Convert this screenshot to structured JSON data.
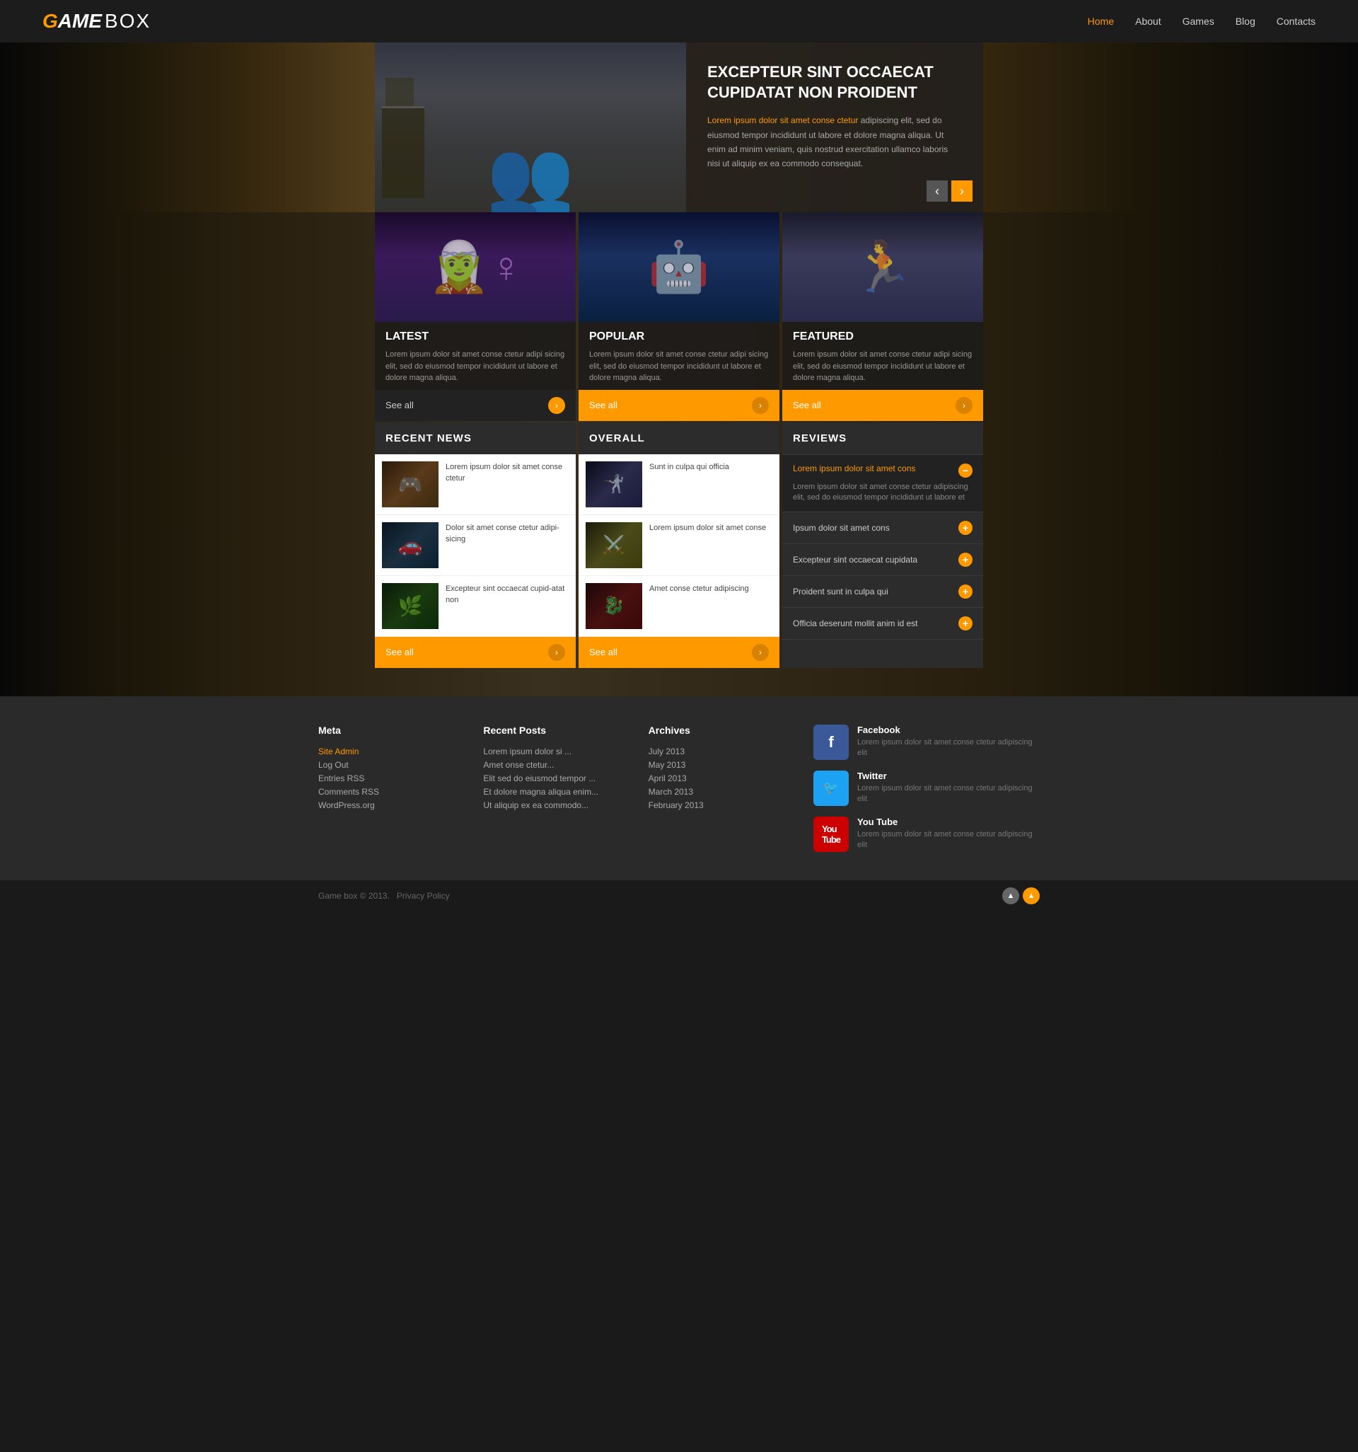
{
  "site": {
    "logo_g": "G",
    "logo_ame": "AME",
    "logo_box": "BOX"
  },
  "nav": {
    "items": [
      {
        "label": "Home",
        "active": true
      },
      {
        "label": "About",
        "active": false
      },
      {
        "label": "Games",
        "active": false
      },
      {
        "label": "Blog",
        "active": false
      },
      {
        "label": "Contacts",
        "active": false
      }
    ]
  },
  "hero": {
    "title": "EXCEPTEUR SINT OCCAECAT CUPIDATAT NON PROIDENT",
    "desc_orange": "Lorem ipsum dolor sit amet conse ctetur",
    "desc": " adipiscing elit, sed do eiusmod tempor incididunt ut labore et dolore magna aliqua. Ut enim ad minim veniam, quis nostrud exercitation ullamco laboris nisi ut aliquip ex ea commodo consequat.",
    "prev": "‹",
    "next": "›"
  },
  "cards": {
    "latest": {
      "title": "LATEST",
      "desc": "Lorem ipsum dolor sit amet conse ctetur adipi sicing elit, sed do eiusmod tempor incididunt ut labore et dolore magna aliqua.",
      "see_all": "See all"
    },
    "popular": {
      "title": "POPULAR",
      "desc": "Lorem ipsum dolor sit amet conse ctetur adipi sicing elit, sed do eiusmod tempor incididunt ut labore et dolore magna aliqua.",
      "see_all": "See all"
    },
    "featured": {
      "title": "FEATURED",
      "desc": "Lorem ipsum dolor sit amet conse ctetur adipi sicing elit, sed do eiusmod tempor incididunt ut labore et dolore magna aliqua.",
      "see_all": "See all"
    }
  },
  "recent_news": {
    "title": "RECENT NEWS",
    "items": [
      {
        "text": "Lorem ipsum dolor sit amet conse ctetur"
      },
      {
        "text": "Dolor sit amet conse ctetur adipi-sicing"
      },
      {
        "text": "Excepteur sint occaecat cupid-atat non"
      }
    ],
    "see_all": "See all"
  },
  "overall": {
    "title": "OVERALL",
    "items": [
      {
        "text": "Sunt in culpa qui officia"
      },
      {
        "text": "Lorem ipsum dolor sit amet conse"
      },
      {
        "text": "Amet conse ctetur adipiscing"
      }
    ],
    "see_all": "See all"
  },
  "reviews": {
    "title": "REVIEWS",
    "active_item": {
      "title": "Lorem ipsum dolor sit amet cons",
      "desc": "Lorem ipsum dolor sit amet conse ctetur adipiscing elit, sed do eiusmod tempor incididunt ut labore et"
    },
    "items": [
      {
        "label": "Ipsum dolor sit amet cons"
      },
      {
        "label": "Excepteur sint occaecat cupidata"
      },
      {
        "label": "Proident sunt in culpa qui"
      },
      {
        "label": "Officia deserunt mollit anim id est"
      }
    ]
  },
  "footer": {
    "meta": {
      "title": "Meta",
      "links": [
        {
          "label": "Site Admin"
        },
        {
          "label": "Log Out"
        },
        {
          "label": "Entries RSS"
        },
        {
          "label": "Comments RSS"
        },
        {
          "label": "WordPress.org"
        }
      ]
    },
    "recent_posts": {
      "title": "Recent Posts",
      "items": [
        {
          "label": "Lorem ipsum dolor si ..."
        },
        {
          "label": "Amet onse ctetur..."
        },
        {
          "label": "Elit sed do eiusmod tempor ..."
        },
        {
          "label": "Et dolore magna aliqua enim..."
        },
        {
          "label": "Ut aliquip ex ea commodo..."
        }
      ]
    },
    "archives": {
      "title": "Archives",
      "items": [
        {
          "label": "July 2013"
        },
        {
          "label": "May 2013"
        },
        {
          "label": "April 2013"
        },
        {
          "label": "March 2013"
        },
        {
          "label": "February 2013"
        }
      ]
    },
    "social": {
      "facebook": {
        "name": "Facebook",
        "desc": "Lorem ipsum dolor sit amet conse ctetur adipiscing elit"
      },
      "twitter": {
        "name": "Twitter",
        "desc": "Lorem ipsum dolor sit amet conse ctetur adipiscing elit"
      },
      "youtube": {
        "name": "You Tube",
        "desc": "Lorem ipsum dolor sit amet conse ctetur adipiscing elit"
      }
    },
    "copyright": "Game box © 2013.",
    "privacy": "Privacy Policy",
    "scroll_up": "▲",
    "scroll_down": "▲"
  }
}
